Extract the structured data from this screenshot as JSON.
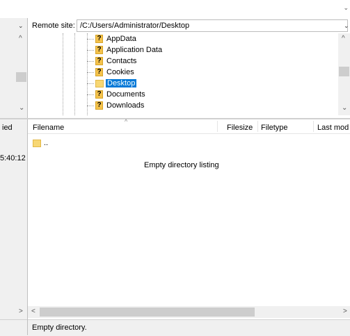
{
  "window": {
    "top_chevron": "⌄"
  },
  "remote": {
    "label": "Remote site:",
    "path": "/C:/Users/Administrator/Desktop",
    "dropdown_icon": "chevron-down-icon",
    "dropdown_glyph": "⌄"
  },
  "left_pane": {
    "dropdown_glyph": "⌄",
    "column_fragment": "ied",
    "time_fragment": "5:40:12"
  },
  "tree": {
    "items": [
      {
        "label": "AppData",
        "icon": "unknown-folder-icon",
        "selected": false
      },
      {
        "label": "Application Data",
        "icon": "unknown-folder-icon",
        "selected": false
      },
      {
        "label": "Contacts",
        "icon": "unknown-folder-icon",
        "selected": false
      },
      {
        "label": "Cookies",
        "icon": "unknown-folder-icon",
        "selected": false
      },
      {
        "label": "Desktop",
        "icon": "folder-icon",
        "selected": true
      },
      {
        "label": "Documents",
        "icon": "unknown-folder-icon",
        "selected": false
      },
      {
        "label": "Downloads",
        "icon": "unknown-folder-icon",
        "selected": false
      }
    ],
    "question_glyph": "?"
  },
  "file_list": {
    "columns": [
      "Filename",
      "Filesize",
      "Filetype",
      "Last mod"
    ],
    "sort_glyph": "^",
    "parent_entry": "..",
    "empty_message": "Empty directory listing"
  },
  "scroll": {
    "up": "^",
    "down": "⌄",
    "left": "<",
    "right": ">"
  },
  "status": {
    "text": "Empty directory."
  }
}
